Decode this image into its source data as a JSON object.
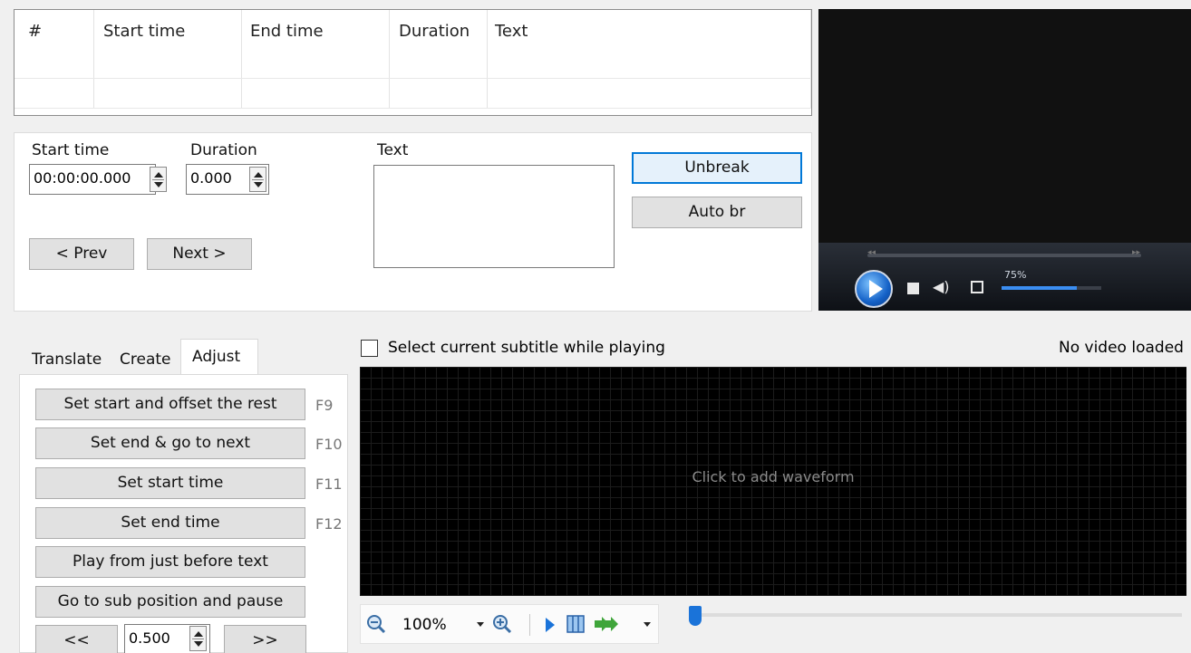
{
  "grid": {
    "columns": [
      "#",
      "Start time",
      "End time",
      "Duration",
      "Text"
    ]
  },
  "editor": {
    "start_time_label": "Start time",
    "start_time_value": "00:00:00.000",
    "duration_label": "Duration",
    "duration_value": "0.000",
    "text_label": "Text",
    "text_value": "",
    "prev_label": "< Prev",
    "next_label": "Next >",
    "unbreak_label": "Unbreak",
    "auto_br_label": "Auto br"
  },
  "video": {
    "volume_percent": "75%",
    "volume_level": 0.75
  },
  "tabs": {
    "items": [
      "Translate",
      "Create",
      "Adjust"
    ],
    "selected": "Adjust"
  },
  "adjust": {
    "set_start_offset": "Set start and offset the rest",
    "set_start_offset_key": "F9",
    "set_end_next": "Set end & go to next",
    "set_end_next_key": "F10",
    "set_start_time": "Set start time",
    "set_start_time_key": "F11",
    "set_end_time": "Set end time",
    "set_end_time_key": "F12",
    "play_before": "Play from just before text",
    "goto_sub_pause": "Go to sub position and pause",
    "back_label": "<<",
    "step_value": "0.500",
    "forward_label": ">>"
  },
  "waveform": {
    "select_current_label": "Select current subtitle while playing",
    "select_current_checked": false,
    "no_video_label": "No video loaded",
    "hint": "Click to add waveform",
    "zoom": "100%",
    "position_fraction": 0.0
  },
  "icons": {
    "zoom_out": "zoom-out-icon",
    "zoom_in": "zoom-in-icon",
    "play": "play-icon",
    "frame": "frame-icon",
    "forward": "forward-arrows-icon"
  }
}
